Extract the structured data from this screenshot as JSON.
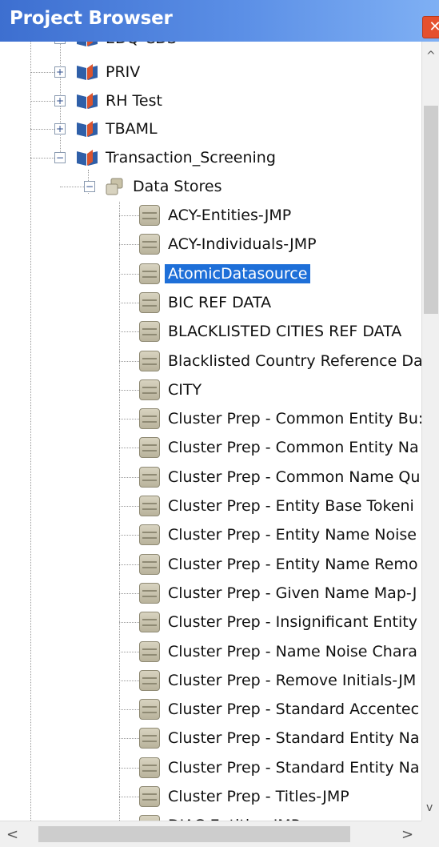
{
  "window": {
    "title": "Project Browser",
    "close_label": "✕"
  },
  "tree": {
    "cutoff_top": "EDQ-CDS",
    "projects": [
      {
        "label": "PRIV",
        "state": "+"
      },
      {
        "label": "RH Test",
        "state": "+"
      },
      {
        "label": "TBAML",
        "state": "+"
      },
      {
        "label": "Transaction_Screening",
        "state": "−"
      }
    ],
    "folder": {
      "label": "Data Stores",
      "state": "−"
    },
    "items": [
      "ACY-Entities-JMP",
      "ACY-Individuals-JMP",
      "AtomicDatasource",
      "BIC REF DATA",
      "BLACKLISTED CITIES REF DATA",
      "Blacklisted Country Reference Da",
      "CITY",
      "Cluster Prep - Common Entity Bu:",
      "Cluster Prep - Common Entity Na",
      "Cluster Prep - Common Name Qu",
      "Cluster Prep - Entity Base Tokeni",
      "Cluster Prep - Entity Name Noise",
      "Cluster Prep - Entity Name Remo",
      "Cluster Prep - Given Name Map-J",
      "Cluster Prep - Insignificant Entity",
      "Cluster Prep - Name Noise Chara",
      "Cluster Prep - Remove Initials-JM",
      "Cluster Prep - Standard Accentec",
      "Cluster Prep - Standard Entity Na",
      "Cluster Prep - Standard Entity Na",
      "Cluster Prep - Titles-JMP",
      "DJAC-Entities-JMP"
    ],
    "selected_index": 2
  },
  "scroll": {
    "up": "^",
    "down": "v",
    "left": "<",
    "right": ">"
  }
}
